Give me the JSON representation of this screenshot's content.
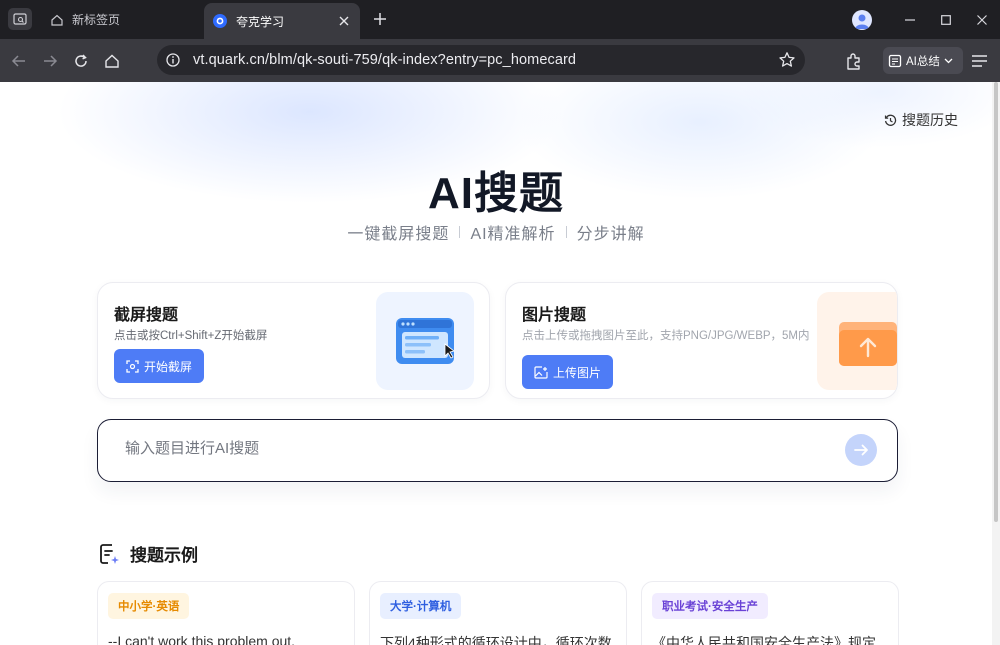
{
  "browser": {
    "tabs": [
      {
        "label": "新标签页",
        "active": false
      },
      {
        "label": "夸克学习",
        "active": true
      }
    ],
    "address": "vt.quark.cn/blm/qk-souti-759/qk-index?entry=pc_homecard",
    "ai_summary_label": "AI总结"
  },
  "page": {
    "history_label": "搜题历史",
    "title": "AI搜题",
    "subtitle": [
      "一键截屏搜题",
      "AI精准解析",
      "分步讲解"
    ],
    "screenshot_card": {
      "title": "截屏搜题",
      "desc": "点击或按Ctrl+Shift+Z开始截屏",
      "button": "开始截屏"
    },
    "image_card": {
      "title": "图片搜题",
      "desc": "点击上传或拖拽图片至此，支持PNG/JPG/WEBP，5M内",
      "button": "上传图片"
    },
    "search": {
      "placeholder": "输入题目进行AI搜题"
    },
    "examples": {
      "heading": "搜题示例",
      "items": [
        {
          "tag": "中小学·英语",
          "text": "--I can't work this problem out."
        },
        {
          "tag": "大学·计算机",
          "text": "下列4种形式的循环设计中，循环次数"
        },
        {
          "tag": "职业考试·安全生产",
          "text": "《中华人民共和国安全生产法》规定"
        }
      ]
    }
  },
  "colors": {
    "accent": "#4e7cf6",
    "tag_english_bg": "#fff5e0",
    "tag_english_fg": "#e68a00",
    "tag_cs_bg": "#e8efff",
    "tag_cs_fg": "#2f5fe0",
    "tag_safety_bg": "#f1ecff",
    "tag_safety_fg": "#6a42d6"
  }
}
